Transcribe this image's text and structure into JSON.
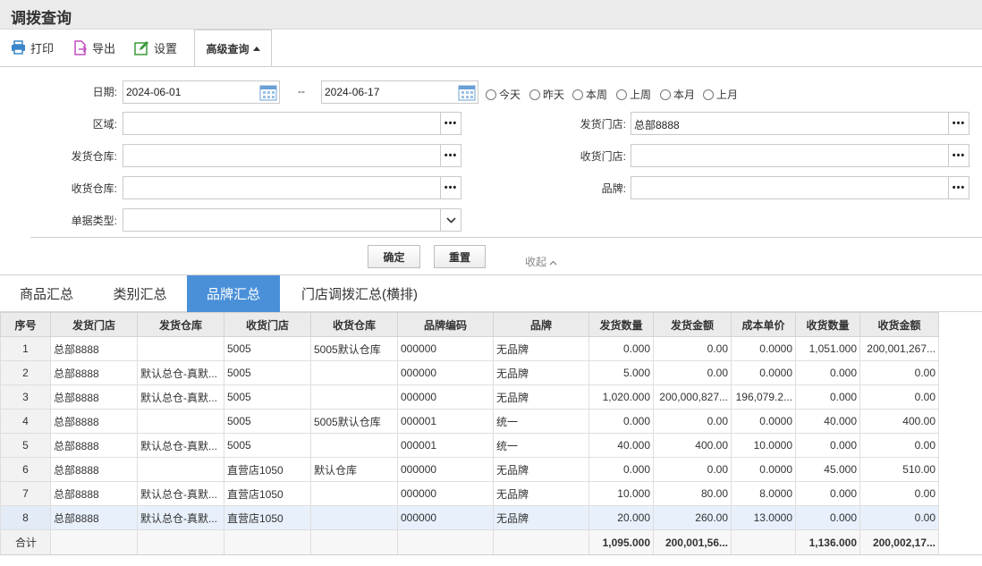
{
  "page": {
    "title": "调拨查询"
  },
  "toolbar": {
    "print": "打印",
    "export": "导出",
    "settings": "设置",
    "advanced": "高级查询"
  },
  "filters": {
    "date_label": "日期:",
    "date_from": "2024-06-01",
    "date_sep": "--",
    "date_to": "2024-06-17",
    "quick_dates": [
      "今天",
      "昨天",
      "本周",
      "上周",
      "本月",
      "上月"
    ],
    "area_label": "区域:",
    "area_value": "",
    "ship_store_label": "发货门店:",
    "ship_store_value": "总部8888",
    "ship_wh_label": "发货仓库:",
    "ship_wh_value": "",
    "recv_store_label": "收货门店:",
    "recv_store_value": "",
    "recv_wh_label": "收货仓库:",
    "recv_wh_value": "",
    "brand_label": "品牌:",
    "brand_value": "",
    "doc_type_label": "单据类型:",
    "doc_type_value": "",
    "confirm": "确定",
    "reset": "重置",
    "collapse": "收起"
  },
  "tabs": [
    "商品汇总",
    "类别汇总",
    "品牌汇总",
    "门店调拨汇总(横排)"
  ],
  "active_tab": "品牌汇总",
  "table": {
    "columns": [
      "序号",
      "发货门店",
      "发货仓库",
      "收货门店",
      "收货仓库",
      "品牌编码",
      "品牌",
      "发货数量",
      "发货金额",
      "成本单价",
      "收货数量",
      "收货金额"
    ],
    "rows": [
      [
        "1",
        "总部8888",
        "",
        "5005",
        "5005默认仓库",
        "000000",
        "无品牌",
        "0.000",
        "0.00",
        "0.0000",
        "1,051.000",
        "200,001,267..."
      ],
      [
        "2",
        "总部8888",
        "默认总仓-真默...",
        "5005",
        "",
        "000000",
        "无品牌",
        "5.000",
        "0.00",
        "0.0000",
        "0.000",
        "0.00"
      ],
      [
        "3",
        "总部8888",
        "默认总仓-真默...",
        "5005",
        "",
        "000000",
        "无品牌",
        "1,020.000",
        "200,000,827...",
        "196,079.2...",
        "0.000",
        "0.00"
      ],
      [
        "4",
        "总部8888",
        "",
        "5005",
        "5005默认仓库",
        "000001",
        "统一",
        "0.000",
        "0.00",
        "0.0000",
        "40.000",
        "400.00"
      ],
      [
        "5",
        "总部8888",
        "默认总仓-真默...",
        "5005",
        "",
        "000001",
        "统一",
        "40.000",
        "400.00",
        "10.0000",
        "0.000",
        "0.00"
      ],
      [
        "6",
        "总部8888",
        "",
        "直营店1050",
        "默认仓库",
        "000000",
        "无品牌",
        "0.000",
        "0.00",
        "0.0000",
        "45.000",
        "510.00"
      ],
      [
        "7",
        "总部8888",
        "默认总仓-真默...",
        "直营店1050",
        "",
        "000000",
        "无品牌",
        "10.000",
        "80.00",
        "8.0000",
        "0.000",
        "0.00"
      ],
      [
        "8",
        "总部8888",
        "默认总仓-真默...",
        "直营店1050",
        "",
        "000000",
        "无品牌",
        "20.000",
        "260.00",
        "13.0000",
        "0.000",
        "0.00"
      ]
    ],
    "total": [
      "合计",
      "",
      "",
      "",
      "",
      "",
      "",
      "1,095.000",
      "200,001,56...",
      "",
      "1,136.000",
      "200,002,17..."
    ]
  }
}
